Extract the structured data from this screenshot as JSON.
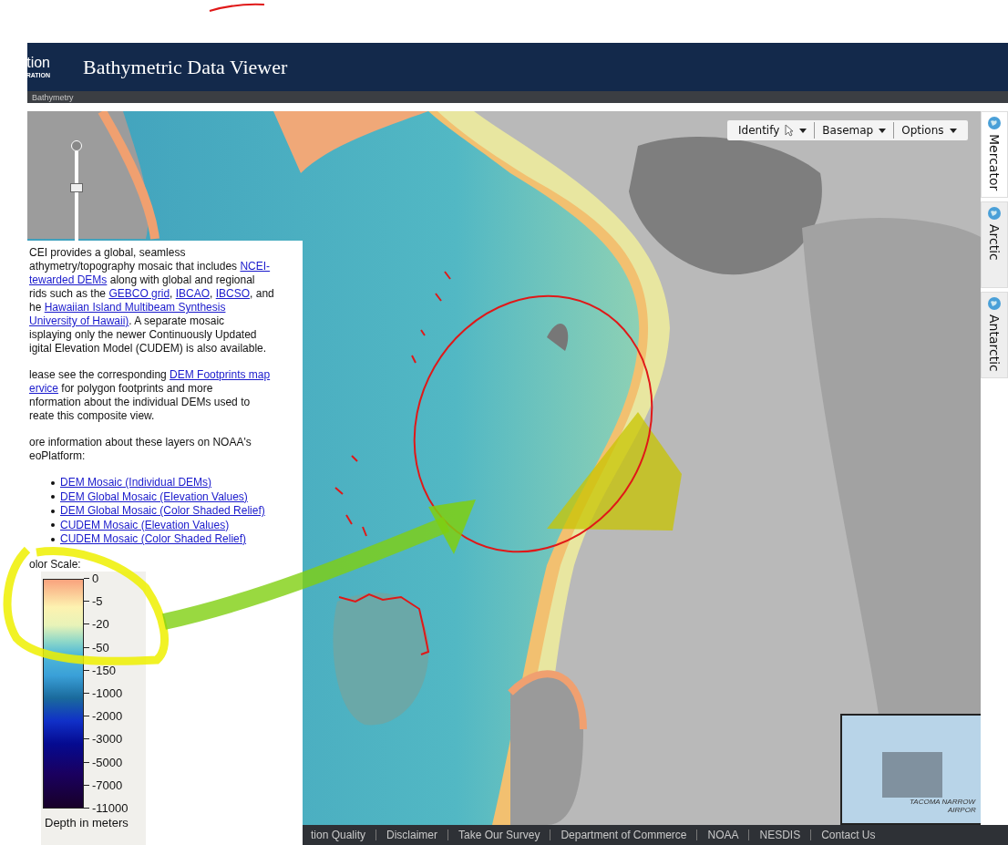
{
  "header": {
    "logo_text": "tion",
    "logo_subtext": "RATION",
    "title": "Bathymetric Data Viewer"
  },
  "breadcrumb": "Bathymetry",
  "zoom_slider": {
    "level": 0.6
  },
  "toolbar": [
    {
      "label": "Identify",
      "kind": "identify"
    },
    {
      "label": "Basemap",
      "kind": "menu"
    },
    {
      "label": "Options",
      "kind": "menu"
    }
  ],
  "projection_tabs": [
    {
      "label": "Mercator",
      "selected": true
    },
    {
      "label": "Arctic",
      "selected": false
    },
    {
      "label": "Antarctic",
      "selected": false
    }
  ],
  "info_panel": {
    "paragraphs": [
      [
        [
          {
            "text": "CEI provides a global, seamless",
            "link": false
          }
        ],
        [
          {
            "text": "athymetry/topography mosaic that includes ",
            "link": false
          },
          {
            "text": "NCEI-",
            "link": true
          }
        ],
        [
          {
            "text": "tewarded DEMs",
            "link": true
          },
          {
            "text": " along with global and regional",
            "link": false
          }
        ],
        [
          {
            "text": "rids such as the ",
            "link": false
          },
          {
            "text": "GEBCO grid",
            "link": true
          },
          {
            "text": ", ",
            "link": false
          },
          {
            "text": "IBCAO",
            "link": true
          },
          {
            "text": ", ",
            "link": false
          },
          {
            "text": "IBCSO",
            "link": true
          },
          {
            "text": ", and",
            "link": false
          }
        ],
        [
          {
            "text": "he ",
            "link": false
          },
          {
            "text": "Hawaiian Island Multibeam Synthesis",
            "link": true
          }
        ],
        [
          {
            "text": "University of Hawaii)",
            "link": true
          },
          {
            "text": ". A separate mosaic",
            "link": false
          }
        ],
        [
          {
            "text": "isplaying only the newer Continuously Updated",
            "link": false
          }
        ],
        [
          {
            "text": "igital Elevation Model (CUDEM) is also available.",
            "link": false
          }
        ]
      ],
      [
        [
          {
            "text": "lease see the corresponding ",
            "link": false
          },
          {
            "text": "DEM Footprints map",
            "link": true
          }
        ],
        [
          {
            "text": "ervice",
            "link": true
          },
          {
            "text": " for polygon footprints and more",
            "link": false
          }
        ],
        [
          {
            "text": "nformation about the individual DEMs used to",
            "link": false
          }
        ],
        [
          {
            "text": "reate this composite view.",
            "link": false
          }
        ]
      ],
      [
        [
          {
            "text": "ore information about these layers on NOAA's",
            "link": false
          }
        ],
        [
          {
            "text": "eoPlatform:",
            "link": false
          }
        ]
      ]
    ],
    "links": [
      "DEM Mosaic (Individual DEMs)",
      "DEM Global Mosaic (Elevation Values)",
      "DEM Global Mosaic (Color Shaded Relief)",
      "CUDEM Mosaic (Elevation Values)",
      "CUDEM Mosaic (Color Shaded Relief)"
    ],
    "color_scale": {
      "title": "olor Scale:",
      "ticks": [
        "0",
        "-5",
        "-20",
        "-50",
        "-150",
        "-1000",
        "-2000",
        "-3000",
        "-5000",
        "-7000",
        "-11000"
      ],
      "caption": "Depth in meters"
    }
  },
  "minimap": {
    "labels": [
      "TACOMA NARROW",
      "AIRPOR"
    ]
  },
  "footer_links": [
    "tion Quality",
    "Disclaimer",
    "Take Our Survey",
    "Department of Commerce",
    "NOAA",
    "NESDIS",
    "Contact Us"
  ]
}
